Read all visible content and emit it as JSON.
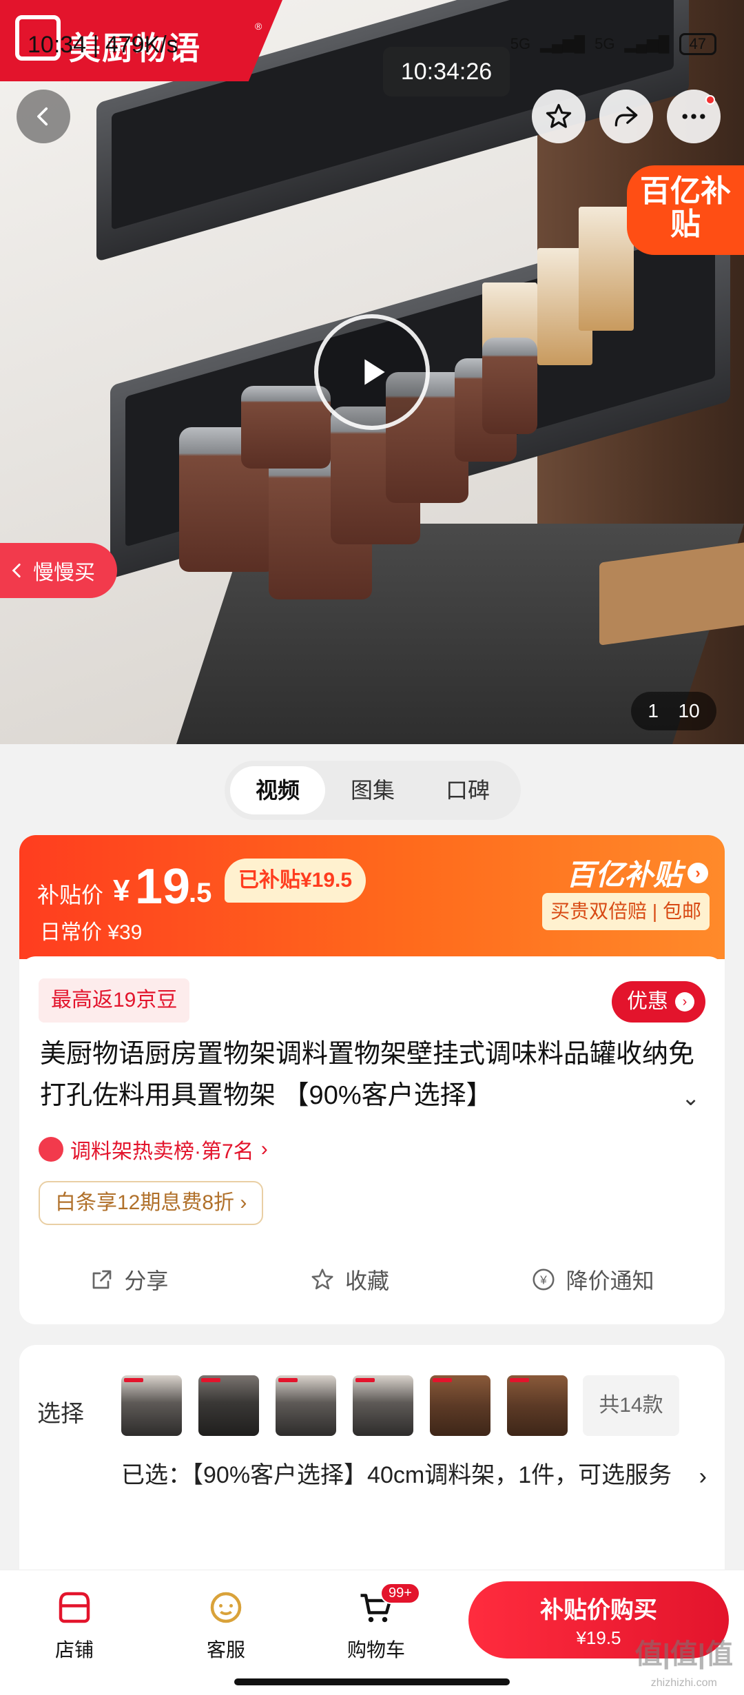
{
  "status_bar": {
    "time": "10:34",
    "speed": "479K/s",
    "network": "5G",
    "battery": "47"
  },
  "brand": {
    "logo_text": "美厨物语",
    "reg": "®"
  },
  "video": {
    "timestamp": "10:34:26"
  },
  "hero": {
    "subsidy_corner": "百亿补贴",
    "slow_buy": "慢慢买",
    "page_current": "1",
    "page_total": "10"
  },
  "media_tabs": [
    {
      "label": "视频",
      "active": true
    },
    {
      "label": "图集",
      "active": false
    },
    {
      "label": "口碑",
      "active": false
    }
  ],
  "price": {
    "label": "补贴价",
    "yen": "¥",
    "integer": "19",
    "decimal": ".5",
    "subsidized_tag": "已补贴¥19.5",
    "daily_price": "日常价 ¥39",
    "brand": "百亿补贴",
    "brand_sub": "买贵双倍赔 | 包邮"
  },
  "promo": {
    "coin_tag": "最高返19京豆",
    "discount_button": "优惠"
  },
  "product": {
    "title": "美厨物语厨房置物架调料置物架壁挂式调味料品罐收纳免打孔佐料用具置物架 【90%客户选择】",
    "rank": "调料架热卖榜·第7名",
    "baitiao": "白条享12期息费8折"
  },
  "actions": [
    {
      "label": "分享",
      "icon": "share-icon"
    },
    {
      "label": "收藏",
      "icon": "star-icon"
    },
    {
      "label": "降价通知",
      "icon": "price-drop-icon"
    }
  ],
  "select": {
    "label": "选择",
    "more_styles": "共14款",
    "selected": "已选：【90%客户选择】40cm调料架，1件，可选服务"
  },
  "bottom_nav": {
    "shop": "店铺",
    "service": "客服",
    "cart": "购物车",
    "cart_badge": "99+",
    "buy_title": "补贴价购买",
    "buy_price": "¥19.5"
  },
  "watermark": {
    "main": "值|值|值",
    "sub": "zhizhizhi.com"
  },
  "colors": {
    "accent": "#e3142c",
    "subsidy_orange": "#ff5a1e",
    "gold_text": "#b0702a"
  }
}
